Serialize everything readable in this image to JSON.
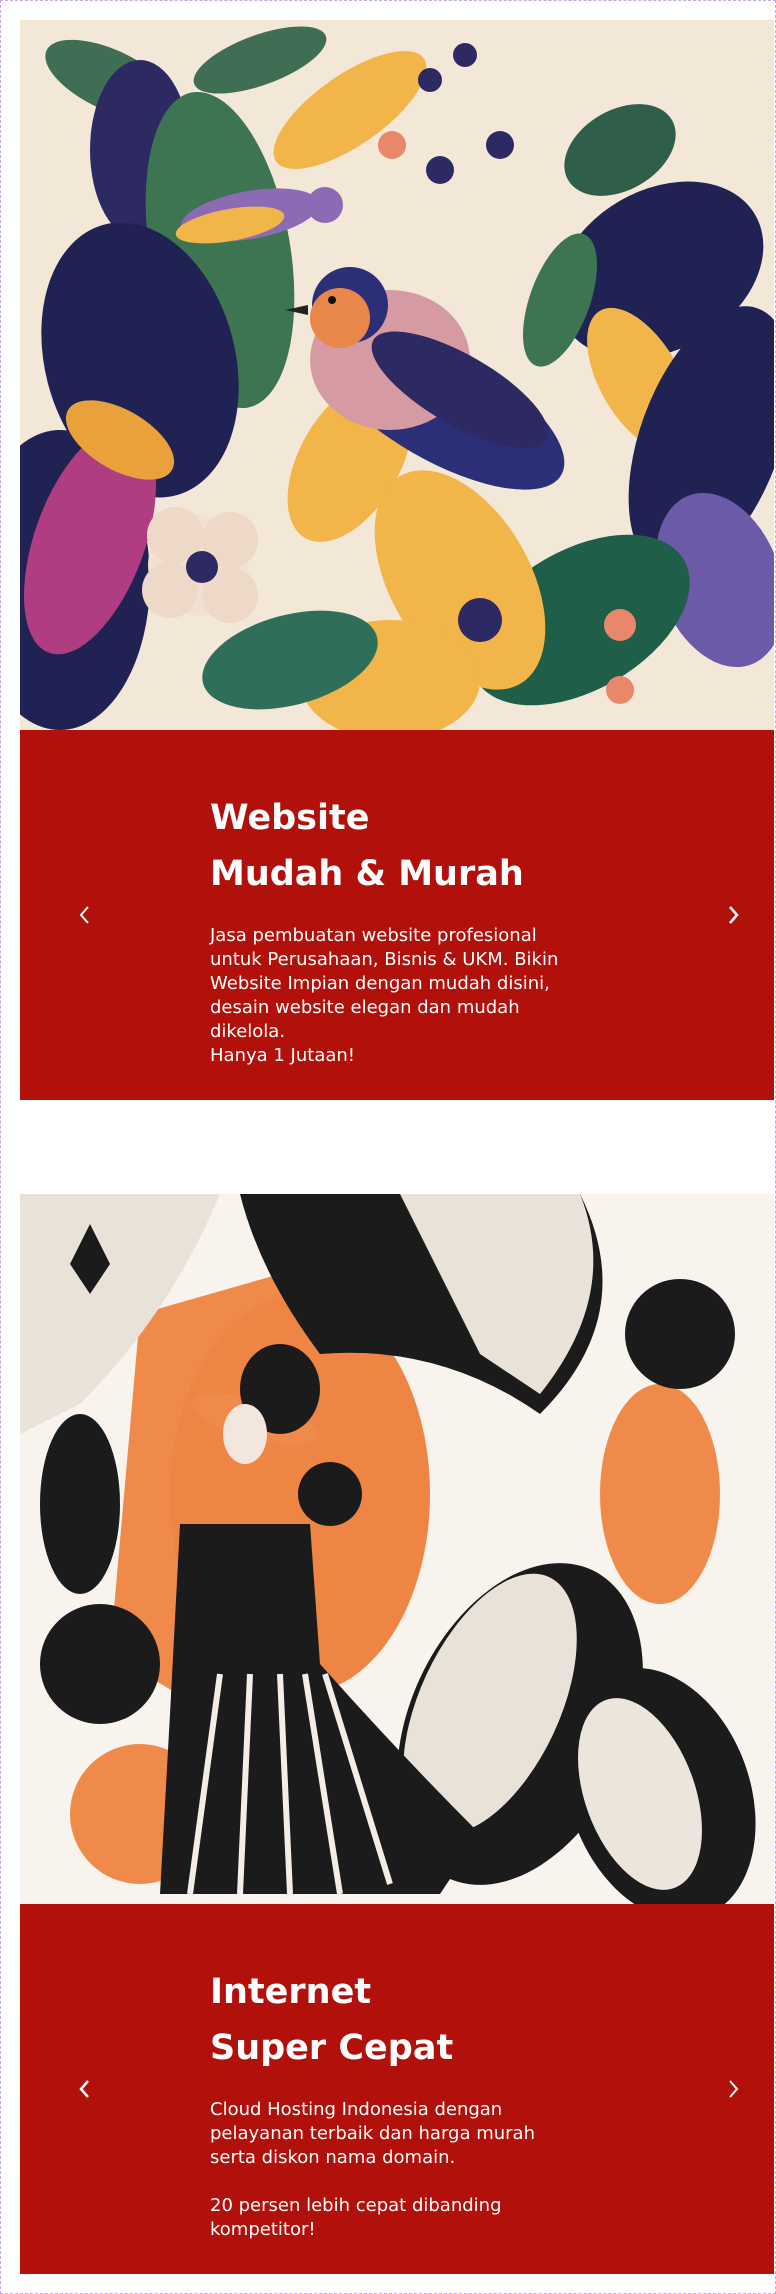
{
  "slides": [
    {
      "title_line1": "Website",
      "title_line2": "Mudah & Murah",
      "description": "Jasa pembuatan website profesional\nuntuk Perusahaan, Bisnis & UKM. Bikin\nWebsite Impian dengan mudah disini,\ndesain website elegan dan mudah\ndikelola.\nHanya 1 Jutaan!",
      "illustration": "bird-and-flowers-illustration",
      "prev_icon": "chevron-left-icon",
      "next_icon": "chevron-right-icon"
    },
    {
      "title_line1": "Internet",
      "title_line2": "Super Cepat",
      "description": "Cloud Hosting Indonesia dengan\npelayanan terbaik dan harga murah\nserta diskon nama domain.\n\n20 persen lebih cepat dibanding\nkompetitor!",
      "illustration": "woman-with-hat-abstract-illustration",
      "prev_icon": "chevron-left-icon",
      "next_icon": "chevron-right-icon"
    }
  ],
  "colors": {
    "panel": "#b1100b",
    "text": "#ffffff"
  }
}
